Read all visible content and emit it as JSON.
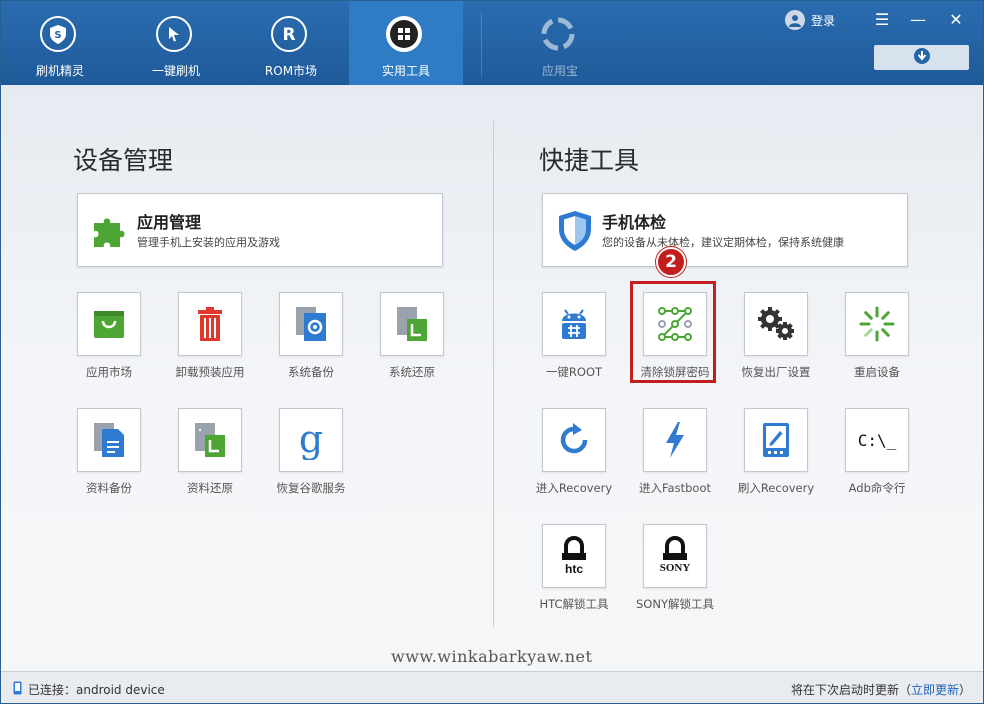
{
  "header": {
    "tabs": [
      {
        "label": "刷机精灵",
        "icon": "shield-s-icon"
      },
      {
        "label": "一键刷机",
        "icon": "cursor-icon"
      },
      {
        "label": "ROM市场",
        "icon": "rom-r-icon"
      },
      {
        "label": "实用工具",
        "icon": "grid-icon",
        "active": true
      }
    ],
    "app_store": {
      "label": "应用宝",
      "icon": "app-store-icon"
    },
    "login_label": "登录",
    "menu_glyph": "☰",
    "minimize_glyph": "—",
    "close_glyph": "✕"
  },
  "device_section": {
    "title": "设备管理",
    "card": {
      "title": "应用管理",
      "subtitle": "管理手机上安装的应用及游戏",
      "icon": "puzzle-icon"
    },
    "tools": [
      {
        "label": "应用市场",
        "icon": "shopping-bag-icon"
      },
      {
        "label": "卸载预装应用",
        "icon": "trash-icon"
      },
      {
        "label": "系统备份",
        "icon": "system-backup-icon"
      },
      {
        "label": "系统还原",
        "icon": "system-restore-icon"
      },
      {
        "label": "资料备份",
        "icon": "data-backup-icon"
      },
      {
        "label": "资料还原",
        "icon": "data-restore-icon"
      },
      {
        "label": "恢复谷歌服务",
        "icon": "google-g-icon"
      }
    ]
  },
  "quick_section": {
    "title": "快捷工具",
    "card": {
      "title": "手机体检",
      "subtitle": "您的设备从未体检，建议定期体检，保持系统健康",
      "icon": "shield-check-icon"
    },
    "tools": [
      {
        "label": "一键ROOT",
        "icon": "android-root-icon"
      },
      {
        "label": "清除锁屏密码",
        "icon": "pattern-lock-icon"
      },
      {
        "label": "恢复出厂设置",
        "icon": "gears-icon"
      },
      {
        "label": "重启设备",
        "icon": "loading-spinner-icon"
      },
      {
        "label": "进入Recovery",
        "icon": "refresh-arrow-icon"
      },
      {
        "label": "进入Fastboot",
        "icon": "lightning-icon"
      },
      {
        "label": "刷入Recovery",
        "icon": "tablet-edit-icon"
      },
      {
        "label": "Adb命令行",
        "icon": "terminal-icon",
        "glyph": "C:\\_"
      },
      {
        "label": "HTC解锁工具",
        "icon": "htc-lock-icon",
        "brand": "htc"
      },
      {
        "label": "SONY解锁工具",
        "icon": "sony-lock-icon",
        "brand": "SONY"
      }
    ]
  },
  "annotation_badge": "2",
  "watermark": "www.winkabarkyaw.net",
  "status": {
    "connection": "已连接：android device",
    "update_text": "将在下次启动时更新（",
    "update_link": "立即更新",
    "update_close": "）"
  },
  "colors": {
    "header": "#2366a8",
    "highlight": "#c31d1d",
    "green": "#4da634",
    "red": "#e0392b",
    "blue": "#2f7bd2",
    "link": "#1f63b8"
  }
}
